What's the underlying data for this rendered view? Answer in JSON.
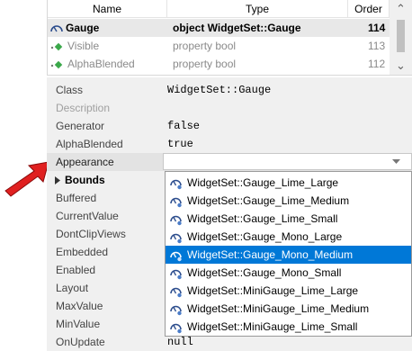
{
  "member_list": {
    "columns": [
      "Name",
      "Type",
      "Order"
    ],
    "rows": [
      {
        "name": "Gauge",
        "type": "object WidgetSet::Gauge",
        "order": "114",
        "selected": true
      },
      {
        "name": "Visible",
        "type": "property bool",
        "order": "113",
        "selected": false
      },
      {
        "name": "AlphaBlended",
        "type": "property bool",
        "order": "112",
        "selected": false
      }
    ]
  },
  "properties": {
    "class": {
      "label": "Class",
      "value": "WidgetSet::Gauge"
    },
    "description": {
      "label": "Description",
      "value": ""
    },
    "generator": {
      "label": "Generator",
      "value": "false"
    },
    "alpha_blended": {
      "label": "AlphaBlended",
      "value": "true"
    },
    "appearance": {
      "label": "Appearance",
      "value": ""
    },
    "bounds": {
      "label": "Bounds"
    },
    "buffered": {
      "label": "Buffered"
    },
    "current_value": {
      "label": "CurrentValue"
    },
    "dont_clip_views": {
      "label": "DontClipViews"
    },
    "embedded": {
      "label": "Embedded"
    },
    "enabled": {
      "label": "Enabled"
    },
    "layout": {
      "label": "Layout"
    },
    "max_value": {
      "label": "MaxValue"
    },
    "min_value": {
      "label": "MinValue"
    },
    "on_update": {
      "label": "OnUpdate",
      "value": "null"
    }
  },
  "appearance_dropdown": {
    "options": [
      "WidgetSet::Gauge_Lime_Large",
      "WidgetSet::Gauge_Lime_Medium",
      "WidgetSet::Gauge_Lime_Small",
      "WidgetSet::Gauge_Mono_Large",
      "WidgetSet::Gauge_Mono_Medium",
      "WidgetSet::Gauge_Mono_Small",
      "WidgetSet::MiniGauge_Lime_Large",
      "WidgetSet::MiniGauge_Lime_Medium",
      "WidgetSet::MiniGauge_Lime_Small"
    ],
    "highlighted": "WidgetSet::Gauge_Mono_Medium"
  },
  "colors": {
    "arrow": "#e02020",
    "highlight": "#0078d7",
    "property_icon": "#3aa84a"
  },
  "icons": [
    "gauge-icon",
    "property-icon",
    "chevron-down-icon",
    "chevron-up-icon",
    "expand-arrow-icon",
    "pointer-arrow-icon"
  ]
}
